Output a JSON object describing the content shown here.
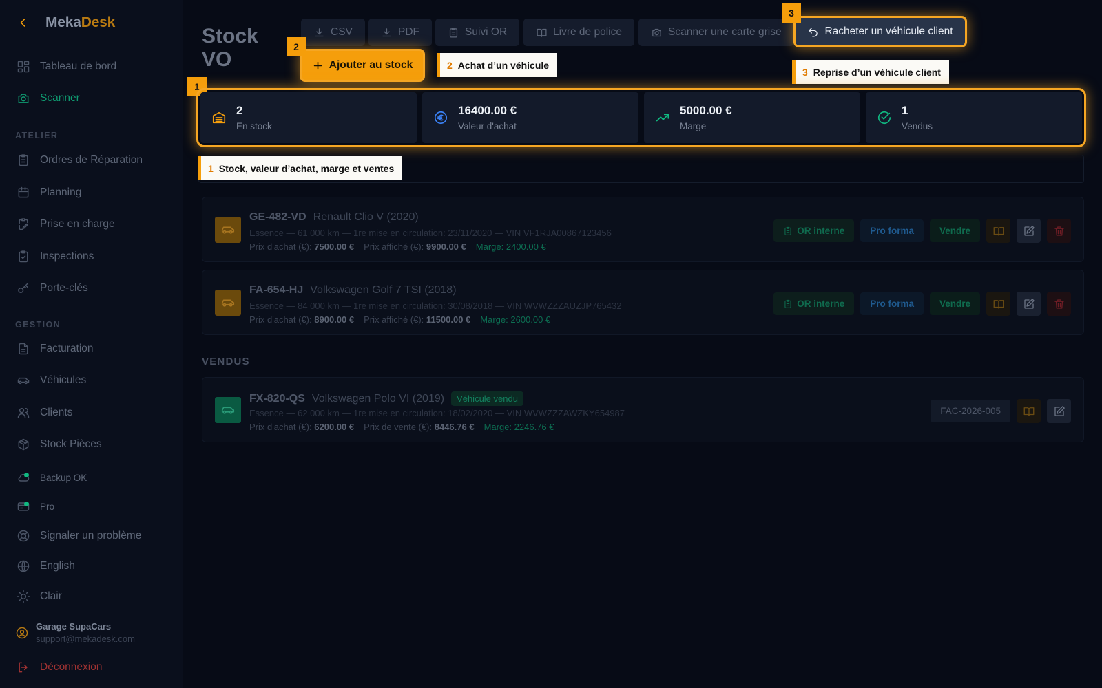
{
  "app": {
    "logo_part1": "Meka",
    "logo_part2": "Desk",
    "accent_color": "#f59e0b"
  },
  "sidebar": {
    "items_top": [
      {
        "label": "Tableau de bord",
        "icon": "dashboard-icon"
      },
      {
        "label": "Scanner",
        "icon": "camera-icon",
        "active": true
      }
    ],
    "section_atelier": "ATELIER",
    "items_atelier": [
      {
        "label": "Ordres de Réparation",
        "icon": "clipboard-icon"
      },
      {
        "label": "Planning",
        "icon": "calendar-icon"
      },
      {
        "label": "Prise en charge",
        "icon": "clipboard-pen-icon"
      },
      {
        "label": "Inspections",
        "icon": "clipboard-check-icon"
      },
      {
        "label": "Porte-clés",
        "icon": "key-icon"
      }
    ],
    "section_gestion": "GESTION",
    "items_gestion": [
      {
        "label": "Facturation",
        "icon": "invoice-icon"
      },
      {
        "label": "Véhicules",
        "icon": "car-icon"
      },
      {
        "label": "Clients",
        "icon": "users-icon"
      },
      {
        "label": "Stock Pièces",
        "icon": "package-icon"
      }
    ],
    "backup": "Backup OK",
    "plan": "Pro",
    "report": "Signaler un problème",
    "language": "English",
    "theme": "Clair",
    "user_name": "Garage SupaCars",
    "user_email": "support@mekadesk.com",
    "logout": "Déconnexion"
  },
  "page": {
    "title": "Stock VO",
    "toolbar": {
      "csv": "CSV",
      "pdf": "PDF",
      "suivi_or": "Suivi OR",
      "livre_police": "Livre de police",
      "scan_card": "Scanner une carte grise",
      "rebuy": "Racheter un véhicule client"
    },
    "add_button": "Ajouter au stock"
  },
  "tour": {
    "step1_num": "1",
    "step1_text": "Stock, valeur d’achat, marge et ventes",
    "step2_num": "2",
    "step2_text": "Achat d’un véhicule",
    "step3_num": "3",
    "step3_text": "Reprise d’un véhicule client"
  },
  "stats": [
    {
      "value": "2",
      "label": "En stock",
      "icon": "stock-icon",
      "color": "#f59e0b"
    },
    {
      "value": "16400.00 €",
      "label": "Valeur d'achat",
      "icon": "euro-icon",
      "color": "#3b82f6"
    },
    {
      "value": "5000.00 €",
      "label": "Marge",
      "icon": "trending-up-icon",
      "color": "#10b981"
    },
    {
      "value": "1",
      "label": "Vendus",
      "icon": "check-circle-icon",
      "color": "#10b981"
    }
  ],
  "labels": {
    "purchase_price": "Prix d'achat (€):",
    "display_price": "Prix affiché (€):",
    "sale_price": "Prix de vente (€):",
    "or_interne": "OR interne",
    "pro_forma": "Pro forma",
    "sell": "Vendre",
    "sold_section": "VENDUS",
    "sold_tag": "Véhicule vendu"
  },
  "stock_vehicles": [
    {
      "plate": "GE-482-VD",
      "model": "Renault Clio V (2020)",
      "details": "Essence — 61 000 km — 1re mise en circulation: 23/11/2020 — VIN VF1RJA00867123456",
      "purchase": "7500.00 €",
      "display": "9900.00 €",
      "margin": "Marge: 2400.00 €"
    },
    {
      "plate": "FA-654-HJ",
      "model": "Volkswagen Golf 7 TSI (2018)",
      "details": "Essence — 84 000 km — 1re mise en circulation: 30/08/2018 — VIN WVWZZZAUZJP765432",
      "purchase": "8900.00 €",
      "display": "11500.00 €",
      "margin": "Marge: 2600.00 €"
    }
  ],
  "sold_vehicles": [
    {
      "plate": "FX-820-QS",
      "model": "Volkswagen Polo VI (2019)",
      "details": "Essence — 62 000 km — 1re mise en circulation: 18/02/2020 — VIN WVWZZZAWZKY654987",
      "purchase": "6200.00 €",
      "sale": "8446.76 €",
      "margin": "Marge: 2246.76 €",
      "invoice": "FAC-2026-005"
    }
  ]
}
